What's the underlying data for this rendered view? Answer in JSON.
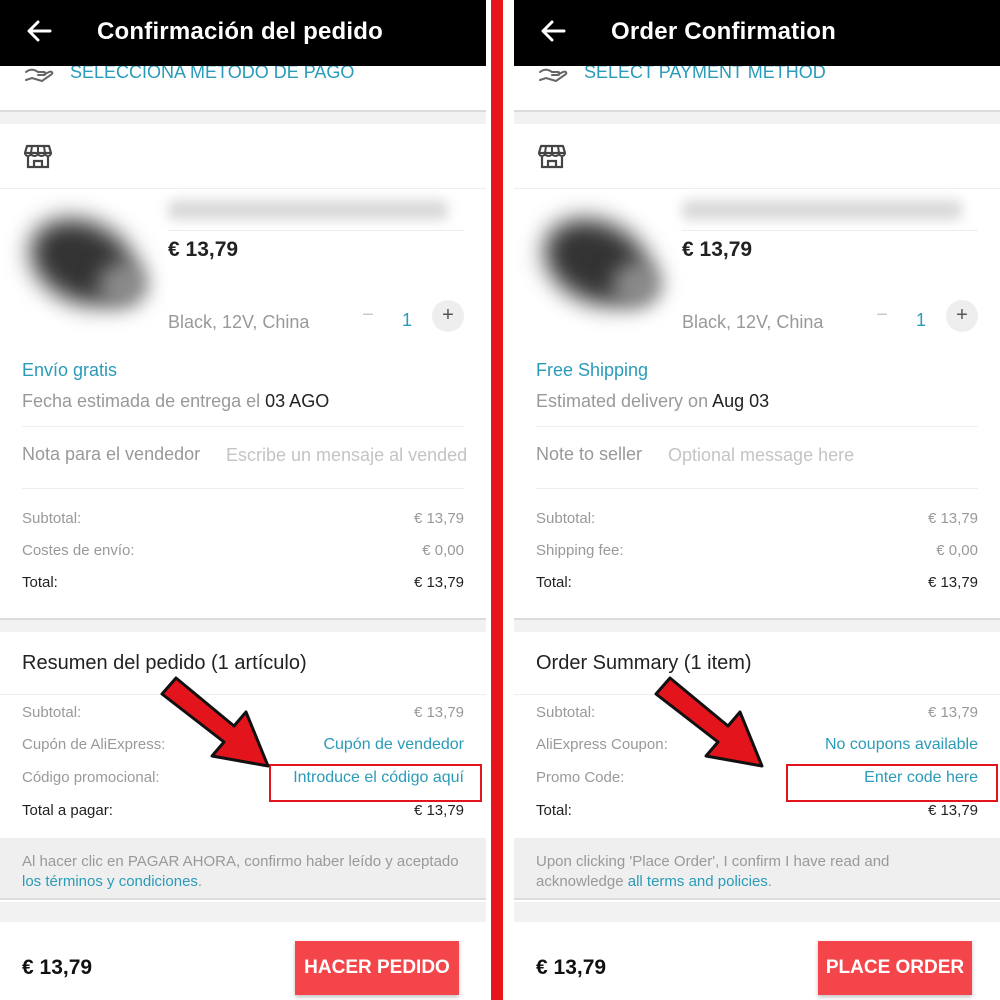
{
  "colors": {
    "accent": "#2a9bb8",
    "order_button": "#f4454a",
    "divider": "#e8141c",
    "highlight": "#e3141c",
    "topbar": "#000000"
  },
  "panels": [
    {
      "header": {
        "title": "Confirmación del pedido",
        "back_icon": "arrow-left-icon"
      },
      "payment": {
        "label": "SELECCIONA MÉTODO DE PAGO",
        "icon": "hand-coin-icon"
      },
      "store": {
        "icon": "store-icon"
      },
      "item": {
        "price": "€ 13,79",
        "variant": "Black, 12V, China",
        "quantity": "1",
        "minus": "−",
        "plus": "+",
        "shipping": "Envío gratis",
        "delivery_prefix": "Fecha estimada de entrega el ",
        "delivery_date": "03 AGO",
        "note_label": "Nota para el vendedor",
        "note_placeholder": "Escribe un mensaje al vendedor"
      },
      "costs": [
        {
          "label": "Subtotal:",
          "value": "€ 13,79"
        },
        {
          "label": "Costes de envío:",
          "value": "€ 0,00"
        },
        {
          "label": "Total:",
          "value": "€ 13,79"
        }
      ],
      "summary": {
        "title": "Resumen del pedido (1 artículo)",
        "subtotal_label": "Subtotal:",
        "subtotal_value": "€ 13,79",
        "coupon_label": "Cupón de AliExpress:",
        "coupon_value": "Cupón de vendedor",
        "promo_label": "Código promocional:",
        "promo_value": "Introduce el código aquí",
        "total_label": "Total a pagar:",
        "total_value": "€ 13,79"
      },
      "terms": {
        "text": "Al hacer clic en PAGAR AHORA, confirmo haber leído y aceptado ",
        "link": "los términos y condiciones",
        "suffix": "."
      },
      "footer": {
        "price": "€ 13,79",
        "button": "HACER PEDIDO"
      }
    },
    {
      "header": {
        "title": "Order Confirmation",
        "back_icon": "arrow-left-icon"
      },
      "payment": {
        "label": "SELECT PAYMENT METHOD",
        "icon": "hand-coin-icon"
      },
      "store": {
        "icon": "store-icon"
      },
      "item": {
        "price": "€ 13,79",
        "variant": "Black, 12V, China",
        "quantity": "1",
        "minus": "−",
        "plus": "+",
        "shipping": "Free Shipping",
        "delivery_prefix": "Estimated delivery on ",
        "delivery_date": "Aug 03",
        "note_label": "Note to seller",
        "note_placeholder": "Optional message here"
      },
      "costs": [
        {
          "label": "Subtotal:",
          "value": "€ 13,79"
        },
        {
          "label": "Shipping fee:",
          "value": "€ 0,00"
        },
        {
          "label": "Total:",
          "value": "€ 13,79"
        }
      ],
      "summary": {
        "title": "Order Summary (1 item)",
        "subtotal_label": "Subtotal:",
        "subtotal_value": "€ 13,79",
        "coupon_label": "AliExpress Coupon:",
        "coupon_value": "No coupons available",
        "promo_label": "Promo Code:",
        "promo_value": "Enter code here",
        "total_label": "Total:",
        "total_value": "€ 13,79"
      },
      "terms": {
        "text": "Upon clicking 'Place Order', I confirm I have read and acknowledge ",
        "link": "all terms and policies",
        "suffix": "."
      },
      "footer": {
        "price": "€ 13,79",
        "button": "PLACE ORDER"
      }
    }
  ]
}
